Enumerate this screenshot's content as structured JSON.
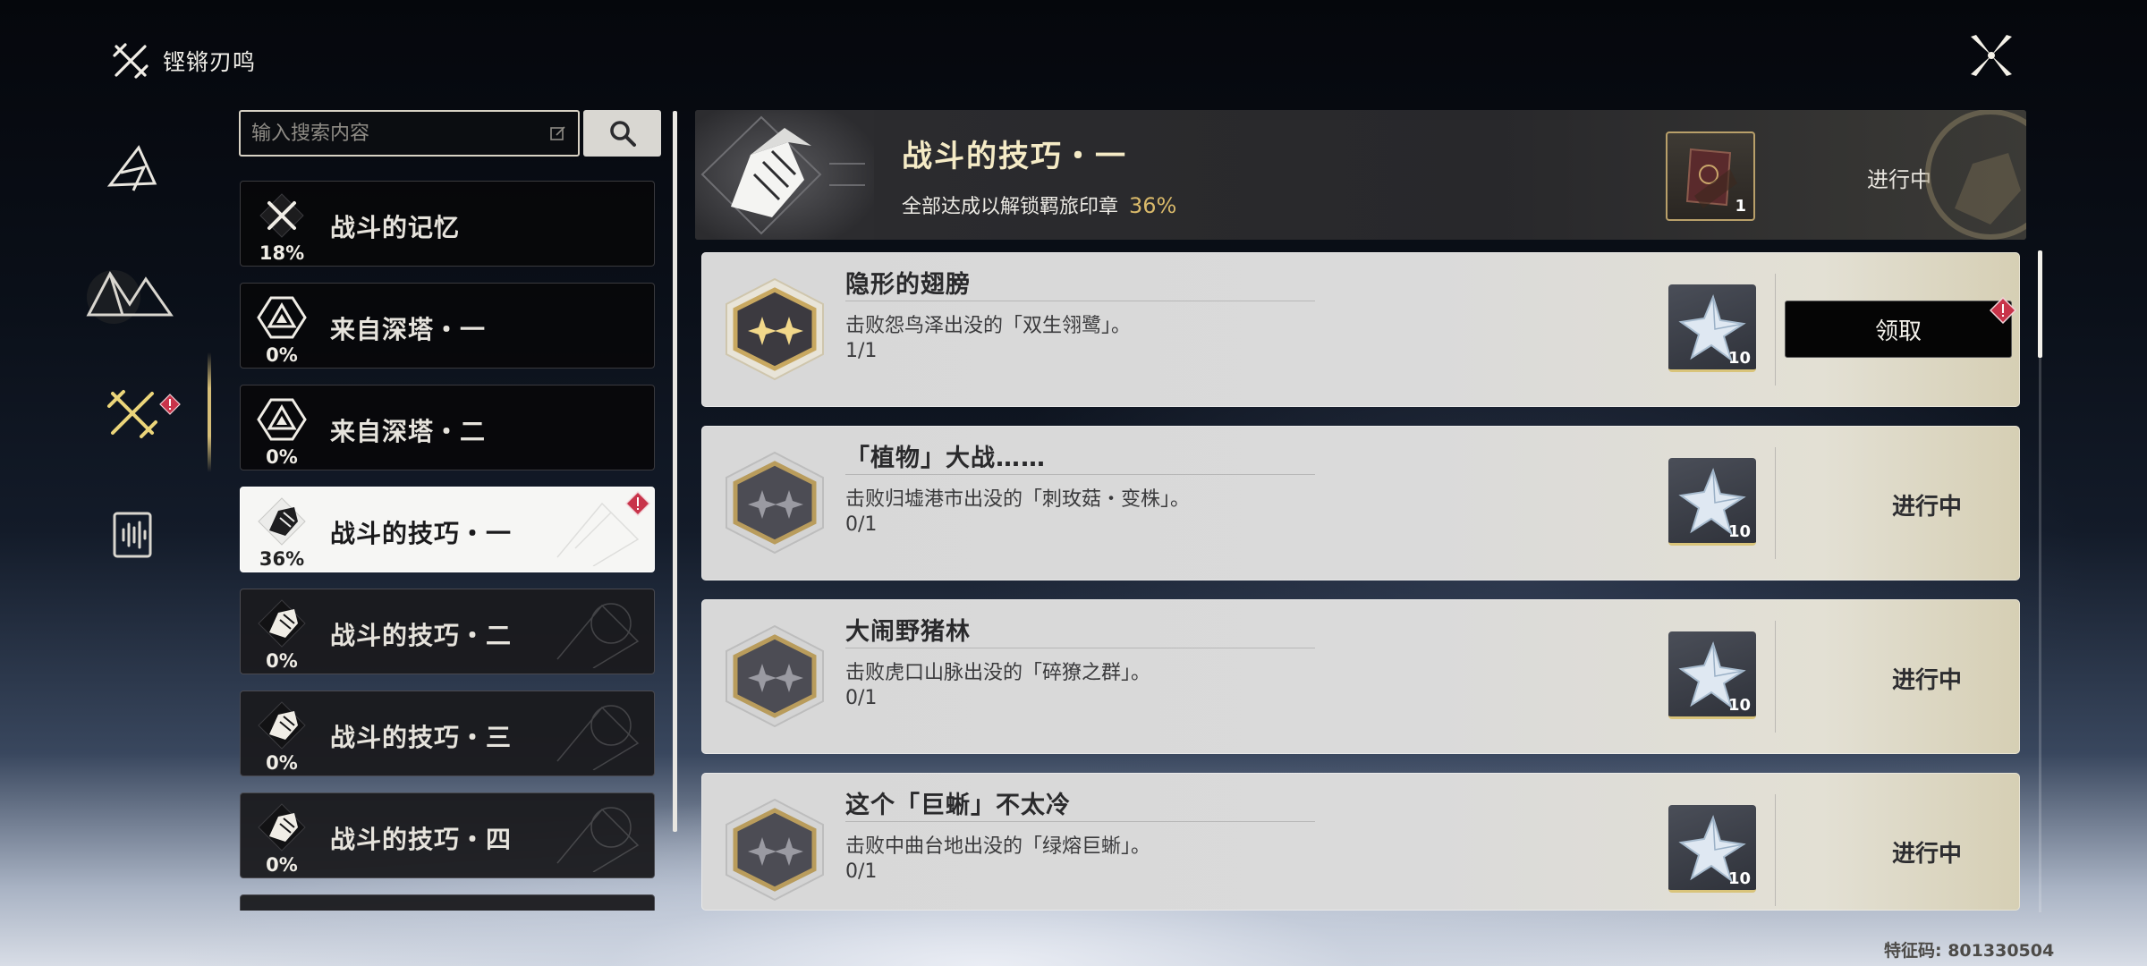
{
  "app": {
    "title": "铿锵刃鸣"
  },
  "search": {
    "placeholder": "输入搜索内容"
  },
  "list": {
    "items": [
      {
        "label": "战斗的记忆",
        "percent": "18%",
        "icon": "crossed-swords-icon",
        "state": "normal"
      },
      {
        "label": "来自深塔・一",
        "percent": "0%",
        "icon": "tower-triangle-icon",
        "state": "normal"
      },
      {
        "label": "来自深塔・二",
        "percent": "0%",
        "icon": "tower-triangle-icon",
        "state": "normal"
      },
      {
        "label": "战斗的技巧・一",
        "percent": "36%",
        "icon": "clasped-hands-icon",
        "state": "active",
        "alert": true
      },
      {
        "label": "战斗的技巧・二",
        "percent": "0%",
        "icon": "clasped-hands-icon",
        "state": "dim"
      },
      {
        "label": "战斗的技巧・三",
        "percent": "0%",
        "icon": "clasped-hands-icon",
        "state": "dim"
      },
      {
        "label": "战斗的技巧・四",
        "percent": "0%",
        "icon": "clasped-hands-icon",
        "state": "dim"
      }
    ]
  },
  "header": {
    "title": "战斗的技巧・一",
    "subtitle": "全部达成以解锁羁旅印章",
    "percent": "36%",
    "reward_count": "1",
    "status": "进行中"
  },
  "tasks": [
    {
      "title": "隐形的翅膀",
      "desc": "击败怨鸟泽出没的「双生翎鹭」。",
      "progress": "1/1",
      "reward_count": "10",
      "action": "领取",
      "claimable": true,
      "badge_style": "gold"
    },
    {
      "title": "「植物」大战……",
      "desc": "击败归墟港市出没的「刺玫菇・变株」。",
      "progress": "0/1",
      "reward_count": "10",
      "action": "进行中",
      "claimable": false,
      "badge_style": "gray"
    },
    {
      "title": "大闹野猪林",
      "desc": "击败虎口山脉出没的「碎獠之群」。",
      "progress": "0/1",
      "reward_count": "10",
      "action": "进行中",
      "claimable": false,
      "badge_style": "gray"
    },
    {
      "title": "这个「巨蜥」不太冷",
      "desc": "击败中曲台地出没的「绿熔巨蜥」。",
      "progress": "0/1",
      "reward_count": "10",
      "action": "进行中",
      "claimable": false,
      "badge_style": "gray"
    }
  ],
  "footer": {
    "code": "特征码: 801330504"
  },
  "colors": {
    "accent_gold": "#d9b96a",
    "alert_red": "#c8344a",
    "card_light": "#d9d9d9"
  }
}
